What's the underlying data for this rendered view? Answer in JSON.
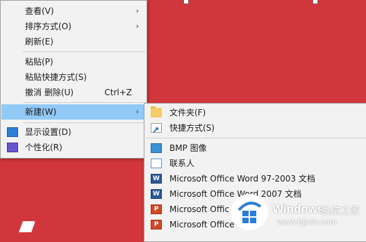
{
  "context_menu": {
    "items": [
      {
        "label": "查看(V)",
        "has_arrow": true
      },
      {
        "label": "排序方式(O)",
        "has_arrow": true
      },
      {
        "label": "刷新(E)"
      },
      {
        "label": "粘贴(P)"
      },
      {
        "label": "粘贴快捷方式(S)"
      },
      {
        "label": "撤消 删除(U)",
        "shortcut": "Ctrl+Z"
      },
      {
        "label": "新建(W)",
        "has_arrow": true,
        "highlighted": true
      },
      {
        "label": "显示设置(D)",
        "icon": "display-settings-icon"
      },
      {
        "label": "个性化(R)",
        "icon": "personalize-icon"
      }
    ]
  },
  "new_submenu": {
    "items": [
      {
        "label": "文件夹(F)",
        "icon": "folder-icon"
      },
      {
        "label": "快捷方式(S)",
        "icon": "shortcut-icon"
      },
      {
        "label": "BMP 图像",
        "icon": "bmp-image-icon"
      },
      {
        "label": "联系人",
        "icon": "contact-icon"
      },
      {
        "label": "Microsoft Office Word 97-2003 文档",
        "icon": "word-doc-icon"
      },
      {
        "label": "Microsoft Office Word 2007 文档",
        "icon": "word-docx-icon"
      },
      {
        "label": "Microsoft Offic",
        "icon": "powerpoint-icon"
      },
      {
        "label": "Microsoft Office",
        "icon": "powerpoint-icon"
      }
    ]
  },
  "watermark": {
    "title": "Windows",
    "subtitle": "系统之家",
    "url": "www.bjjmlv.com"
  },
  "colors": {
    "desktop": "#d1363c",
    "menu_bg": "#f2f2f2",
    "highlight": "#91c9f7"
  }
}
